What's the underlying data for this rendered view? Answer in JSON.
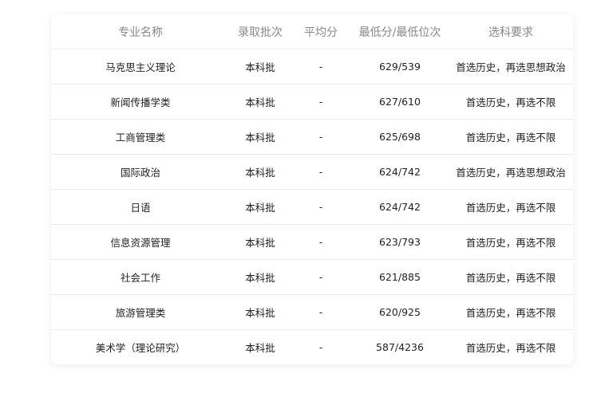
{
  "table": {
    "headers": [
      "专业名称",
      "录取批次",
      "平均分",
      "最低分/最低位次",
      "选科要求"
    ],
    "rows": [
      [
        "马克思主义理论",
        "本科批",
        "-",
        "629/539",
        "首选历史，再选思想政治"
      ],
      [
        "新闻传播学类",
        "本科批",
        "-",
        "627/610",
        "首选历史，再选不限"
      ],
      [
        "工商管理类",
        "本科批",
        "-",
        "625/698",
        "首选历史，再选不限"
      ],
      [
        "国际政治",
        "本科批",
        "-",
        "624/742",
        "首选历史，再选思想政治"
      ],
      [
        "日语",
        "本科批",
        "-",
        "624/742",
        "首选历史，再选不限"
      ],
      [
        "信息资源管理",
        "本科批",
        "-",
        "623/793",
        "首选历史，再选不限"
      ],
      [
        "社会工作",
        "本科批",
        "-",
        "621/885",
        "首选历史，再选不限"
      ],
      [
        "旅游管理类",
        "本科批",
        "-",
        "620/925",
        "首选历史，再选不限"
      ],
      [
        "美术学（理论研究）",
        "本科批",
        "-",
        "587/4236",
        "首选历史，再选不限"
      ]
    ]
  }
}
